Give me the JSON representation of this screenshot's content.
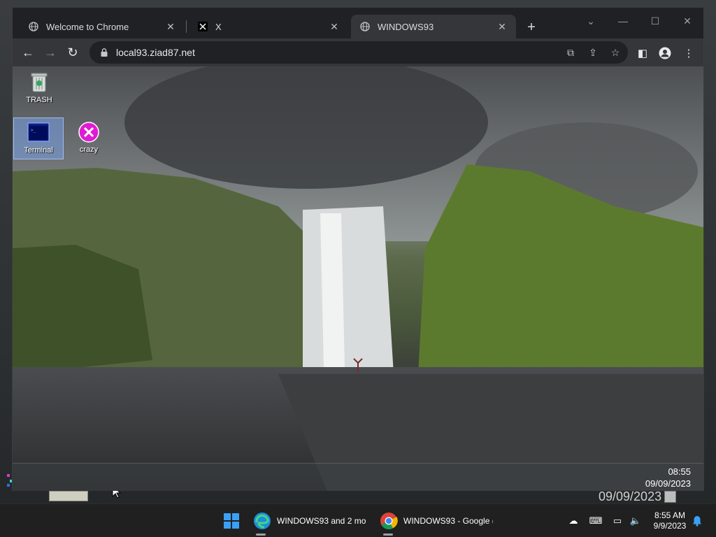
{
  "browser": {
    "tabs": [
      {
        "title": "Welcome to Chrome",
        "icon": "globe-icon",
        "active": false
      },
      {
        "title": "X",
        "icon": "x-logo-icon",
        "active": false
      },
      {
        "title": "WINDOWS93",
        "icon": "globe-icon",
        "active": true
      }
    ],
    "url": "local93.ziad87.net"
  },
  "desktop": {
    "icons": [
      {
        "label": "TRASH",
        "icon": "trash-icon"
      },
      {
        "label": "Terminal",
        "icon": "terminal-icon"
      },
      {
        "label": "crazy",
        "icon": "crazy-icon"
      }
    ],
    "clock_time": "08:55",
    "clock_date": "09/09/2023",
    "ghost_date": "09/09/2023"
  },
  "taskbar": {
    "items": [
      {
        "label": "WINDOWS93 and 2 mo",
        "icon": "edge-icon"
      },
      {
        "label": "WINDOWS93 - Google (",
        "icon": "chrome-icon"
      }
    ],
    "time": "8:55 AM",
    "date": "9/9/2023"
  },
  "colors": {
    "chrome_frame": "#202124",
    "chrome_toolbar": "#35363a",
    "taskbar": "#202020",
    "selection": "#78a0e6"
  }
}
